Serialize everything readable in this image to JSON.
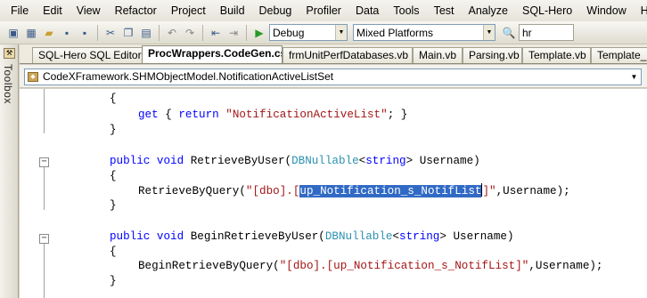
{
  "menu": [
    "File",
    "Edit",
    "View",
    "Refactor",
    "Project",
    "Build",
    "Debug",
    "Profiler",
    "Data",
    "Tools",
    "Test",
    "Analyze",
    "SQL-Hero",
    "Window",
    "Help"
  ],
  "toolbar": {
    "config": "Debug",
    "platform": "Mixed Platforms",
    "find_text": "hr"
  },
  "toolbox_label": "Toolbox",
  "tabs": [
    {
      "label": "SQL-Hero SQL Editor",
      "active": false
    },
    {
      "label": "ProcWrappers.CodeGen.cs",
      "active": true
    },
    {
      "label": "frmUnitPerfDatabases.vb",
      "active": false
    },
    {
      "label": "Main.vb",
      "active": false
    },
    {
      "label": "Parsing.vb",
      "active": false
    },
    {
      "label": "Template.vb",
      "active": false
    },
    {
      "label": "Template_",
      "active": false
    }
  ],
  "nav_combo": "CodeXFramework.SHMObjectModel.NotificationActiveListSet",
  "code": {
    "l1": "{",
    "l2_kw": "get",
    "l2_a": " { ",
    "l2_kw2": "return",
    "l2_sp": " ",
    "l2_str": "\"NotificationActiveList\"",
    "l2_b": "; }",
    "l3": "}",
    "l4_kw1": "public",
    "l4_kw2": "void",
    "l4_name": " RetrieveByUser(",
    "l4_type": "DBNullable",
    "l4_lt": "<",
    "l4_kw3": "string",
    "l4_rest": "> Username)",
    "l5": "{",
    "l6_a": "RetrieveByQuery(",
    "l6_str1": "\"[dbo].[",
    "l6_sel": "up_Notification_s_NotifList",
    "l6_str2": "]\"",
    "l6_b": ",Username);",
    "l7": "}",
    "l8_kw1": "public",
    "l8_kw2": "void",
    "l8_name": " BeginRetrieveByUser(",
    "l8_type": "DBNullable",
    "l8_lt": "<",
    "l8_kw3": "string",
    "l8_rest": "> Username)",
    "l9": "{",
    "l10_a": "BeginRetrieveByQuery(",
    "l10_str": "\"[dbo].[up_Notification_s_NotifList]\"",
    "l10_b": ",Username);",
    "l11": "}"
  }
}
